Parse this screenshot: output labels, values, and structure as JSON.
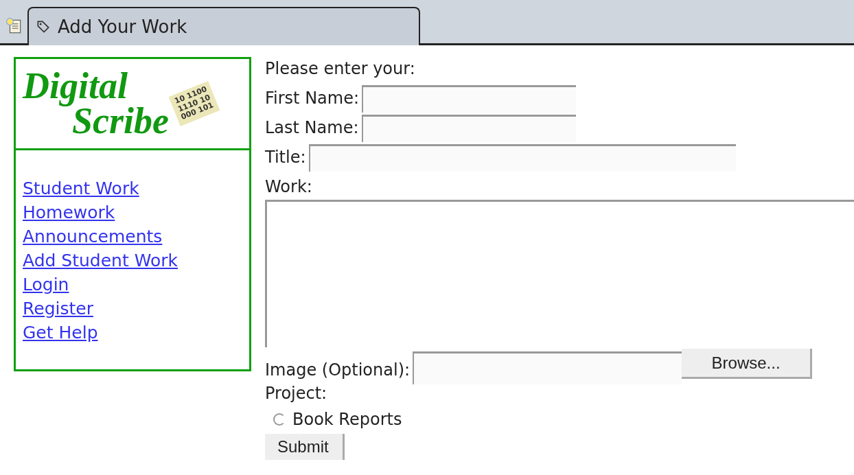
{
  "tab": {
    "label": "Add Your Work"
  },
  "logo": {
    "lines": [
      "Digital",
      "Scribe"
    ],
    "binary": [
      "10 1100",
      "1110 10",
      "000 101"
    ]
  },
  "nav": [
    "Student Work",
    "Homework",
    "Announcements",
    "Add Student Work",
    "Login",
    "Register",
    "Get Help"
  ],
  "form": {
    "intro": "Please enter your:",
    "fields": [
      {
        "kind": "text",
        "label": "First Name:"
      },
      {
        "kind": "text",
        "label": "Last Name:"
      },
      {
        "kind": "widetext",
        "label": "Title:"
      },
      {
        "kind": "textarea",
        "label": "Work:"
      },
      {
        "kind": "file",
        "label": "Image (Optional):",
        "button": "Browse..."
      }
    ],
    "project_label": "Project:",
    "projects": [
      {
        "label": "Book Reports",
        "selected": false
      }
    ],
    "submit": "Submit"
  }
}
